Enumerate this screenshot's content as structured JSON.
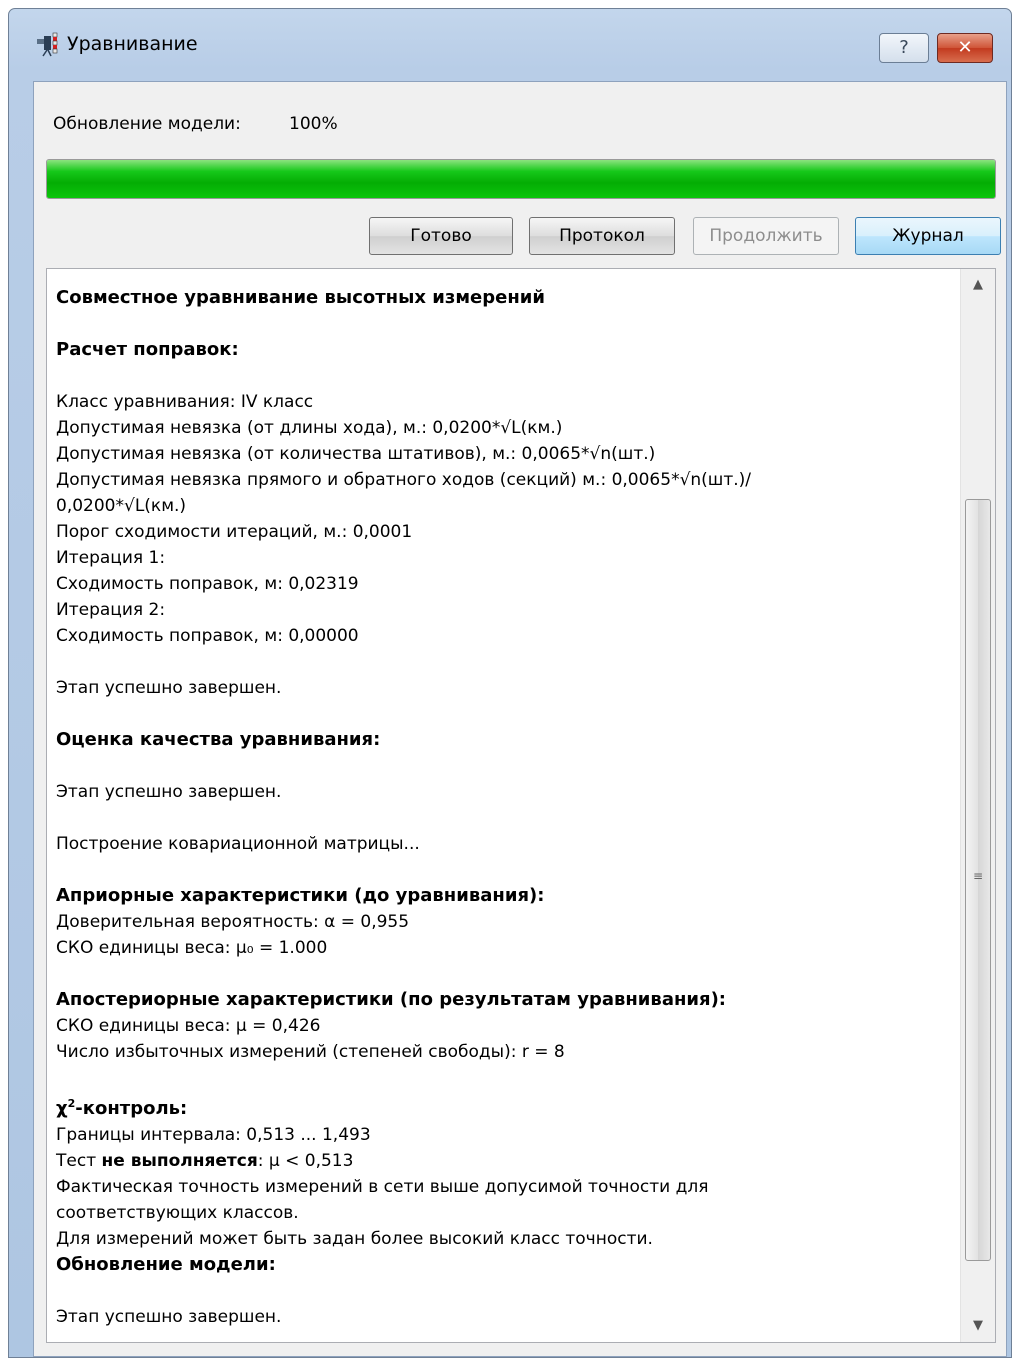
{
  "window": {
    "title": "Уравнивание",
    "help_label": "?",
    "close_label": "✕"
  },
  "status": {
    "label": "Обновление модели:",
    "value": "100%",
    "progress": 1.0
  },
  "buttons": {
    "done": "Готово",
    "protocol": "Протокол",
    "continue": "Продолжить",
    "journal": "Журнал"
  },
  "log": {
    "heading": "Совместное уравнивание высотных измерений",
    "corrections_title": "Расчет поправок:",
    "class_line": "Класс уравнивания: IV класс",
    "tol_length": "Допустимая невязка (от длины хода), м.: 0,0200*√L(км.)",
    "tol_count": "Допустимая невязка (от количества штативов), м.: 0,0065*√n(шт.)",
    "tol_direct_1": "Допустимая невязка прямого и обратного ходов (секций) м.: 0,0065*√n(шт.)/",
    "tol_direct_2": "0,0200*√L(км.)",
    "threshold": "Порог сходимости итераций, м.: 0,0001",
    "iter1": "Итерация 1:",
    "conv1": "Сходимость поправок, м: 0,02319",
    "iter2": "Итерация 2:",
    "conv2": "Сходимость поправок, м: 0,00000",
    "stage_done_1": "Этап успешно завершен.",
    "quality_title": "Оценка качества уравнивания:",
    "stage_done_2": "Этап успешно завершен.",
    "cov_build": "Построение ковариационной матрицы...",
    "apriori_title": "Априорные характеристики (до уравнивания):",
    "confidence": "Доверительная вероятность: α = 0,955",
    "sko_apriori": "СКО единицы веса: μ₀ = 1.000",
    "aposteriori_title": "Апостериорные характеристики (по результатам уравнивания):",
    "sko_aposteriori": "СКО единицы веса: μ = 0,426",
    "redundant": "Число избыточных измерений (степеней свободы): r = 8",
    "chi_symbol": "χ",
    "chi_sup": "2",
    "chi_rest": "-контроль:",
    "bounds": "Границы интервала: 0,513 ... 1,493",
    "test_prefix": "Тест ",
    "test_bold": "не выполняется",
    "test_suffix": ": μ < 0,513",
    "fact_1": "Фактическая точность измерений в сети выше допусимой точности для",
    "fact_2": "соответствующих классов.",
    "suggest": "Для измерений может быть задан более высокий класс точности.",
    "update_title": "Обновление модели:",
    "stage_done_3": "Этап успешно завершен."
  },
  "colors": {
    "progress": "#04ad04",
    "title_bar": "#b8cde7",
    "close": "#c23a1f"
  },
  "icons": [
    "level-app-icon",
    "help-icon",
    "close-icon",
    "scroll-up-icon",
    "scroll-down-icon",
    "scroll-grip-icon"
  ]
}
